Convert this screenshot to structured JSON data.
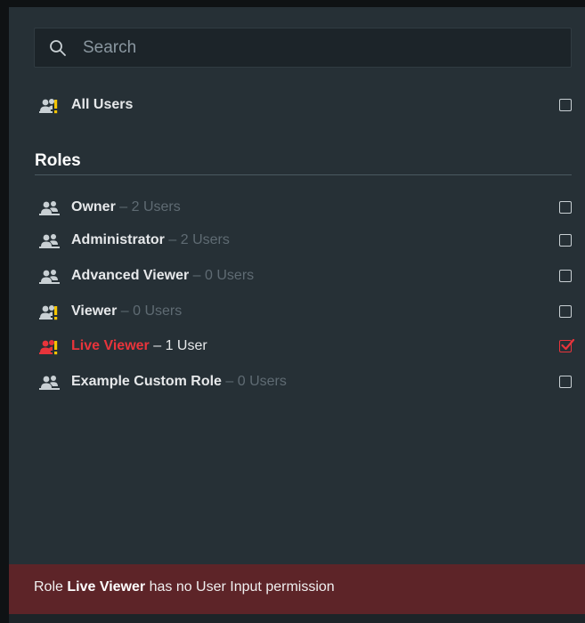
{
  "search": {
    "placeholder": "Search",
    "value": ""
  },
  "all_users": {
    "label": "All Users",
    "icon": "user-group-warning-icon",
    "checked": false
  },
  "roles_section": {
    "title": "Roles"
  },
  "roles": [
    {
      "name": "Owner",
      "separator": "–",
      "count": "2 Users",
      "icon": "user-group-icon",
      "checked": false
    },
    {
      "name": "Administrator",
      "separator": "–",
      "count": "2 Users",
      "icon": "user-group-icon",
      "checked": false
    },
    {
      "name": "Advanced Viewer",
      "separator": "–",
      "count": "0 Users",
      "icon": "user-group-icon",
      "checked": false
    },
    {
      "name": "Viewer",
      "separator": "–",
      "count": "0 Users",
      "icon": "user-group-warning-icon",
      "checked": false
    },
    {
      "name": "Live Viewer",
      "separator": "–",
      "count": "1 User",
      "icon": "user-group-warning-icon",
      "checked": true,
      "alert": true
    },
    {
      "name": "Example Custom Role",
      "separator": "–",
      "count": "0 Users",
      "icon": "user-group-icon",
      "checked": false
    }
  ],
  "footer": {
    "prefix": "Role ",
    "role": "Live Viewer",
    "suffix": " has no User Input permission"
  },
  "colors": {
    "panel": "#263036",
    "alert_red": "#e8343b",
    "warning_yellow": "#f5c400",
    "footer_bg": "#5d2428"
  }
}
